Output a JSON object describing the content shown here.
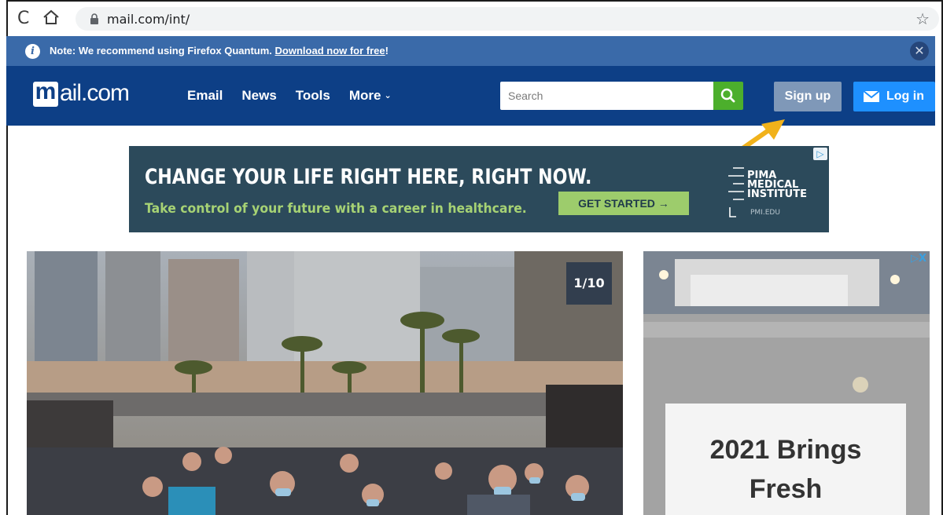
{
  "browser": {
    "url": "mail.com/int/",
    "icons": [
      "reload-icon",
      "home-icon",
      "lock-icon",
      "star-icon"
    ]
  },
  "notice": {
    "text": "Note: We recommend using Firefox Quantum.",
    "link": "Download now for free",
    "suffix": "!"
  },
  "header": {
    "logo_text": "ail.com",
    "logo_mark": "m",
    "nav": [
      "Email",
      "News",
      "Tools",
      "More"
    ],
    "search_placeholder": "Search",
    "signup": "Sign up",
    "login": "Log in",
    "brand_color": "#0d3f86"
  },
  "ad_banner": {
    "headline": "CHANGE YOUR LIFE RIGHT HERE, RIGHT NOW.",
    "subline": "Take control of your future with a career in healthcare.",
    "cta": "GET STARTED →",
    "brand": [
      "PIMA",
      "MEDICAL",
      "INSTITUTE"
    ],
    "brand_url": "PMI.EDU"
  },
  "gallery": {
    "counter": "1/10"
  },
  "side_ad": {
    "line1": "2021 Brings",
    "line2": "Fresh"
  }
}
